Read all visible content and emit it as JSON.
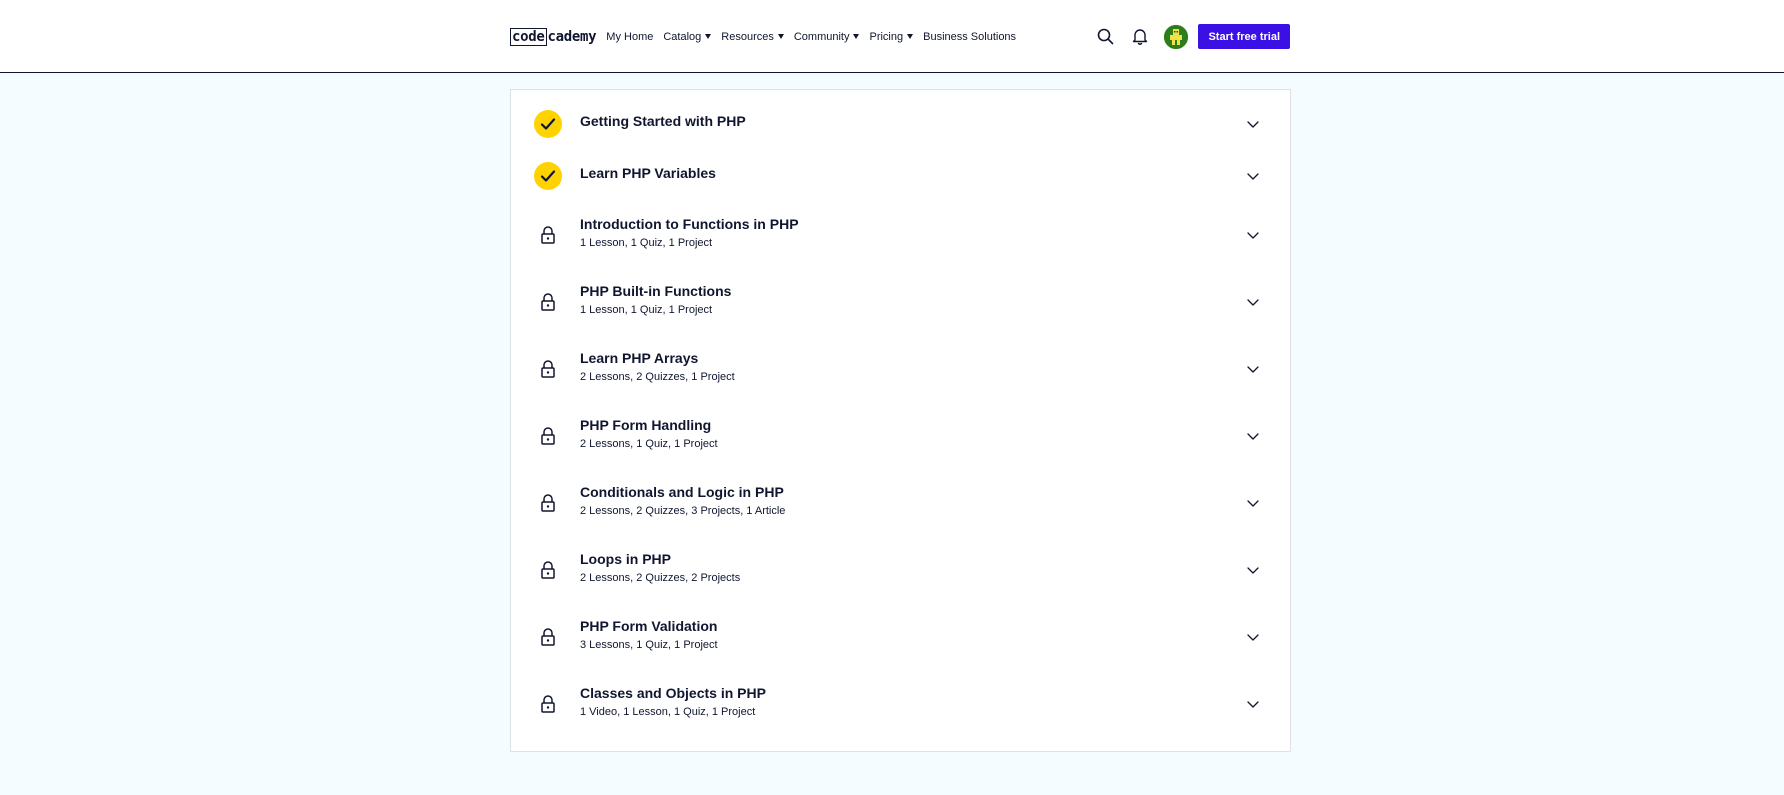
{
  "header": {
    "logo_code": "code",
    "logo_academy": "cademy",
    "nav": [
      {
        "label": "My Home",
        "has_caret": false
      },
      {
        "label": "Catalog",
        "has_caret": true
      },
      {
        "label": "Resources",
        "has_caret": true
      },
      {
        "label": "Community",
        "has_caret": true
      },
      {
        "label": "Pricing",
        "has_caret": true
      },
      {
        "label": "Business Solutions",
        "has_caret": false
      }
    ],
    "search_icon": "search-icon",
    "bell_icon": "bell-icon",
    "cta_label": "Start free trial",
    "accent_color": "#3a10e5"
  },
  "modules": [
    {
      "title": "Getting Started with PHP",
      "meta": "",
      "status": "completed"
    },
    {
      "title": "Learn PHP Variables",
      "meta": "",
      "status": "completed"
    },
    {
      "title": "Introduction to Functions in PHP",
      "meta": "1 Lesson, 1 Quiz, 1 Project",
      "status": "locked"
    },
    {
      "title": "PHP Built-in Functions",
      "meta": "1 Lesson, 1 Quiz, 1 Project",
      "status": "locked"
    },
    {
      "title": "Learn PHP Arrays",
      "meta": "2 Lessons, 2 Quizzes, 1 Project",
      "status": "locked"
    },
    {
      "title": "PHP Form Handling",
      "meta": "2 Lessons, 1 Quiz, 1 Project",
      "status": "locked"
    },
    {
      "title": "Conditionals and Logic in PHP",
      "meta": "2 Lessons, 2 Quizzes, 3 Projects, 1 Article",
      "status": "locked"
    },
    {
      "title": "Loops in PHP",
      "meta": "2 Lessons, 2 Quizzes, 2 Projects",
      "status": "locked"
    },
    {
      "title": "PHP Form Validation",
      "meta": "3 Lessons, 1 Quiz, 1 Project",
      "status": "locked"
    },
    {
      "title": "Classes and Objects in PHP",
      "meta": "1 Video, 1 Lesson, 1 Quiz, 1 Project",
      "status": "locked"
    }
  ],
  "colors": {
    "completed_badge": "#ffd300",
    "page_background": "#f5fcff",
    "text": "#10162f"
  }
}
